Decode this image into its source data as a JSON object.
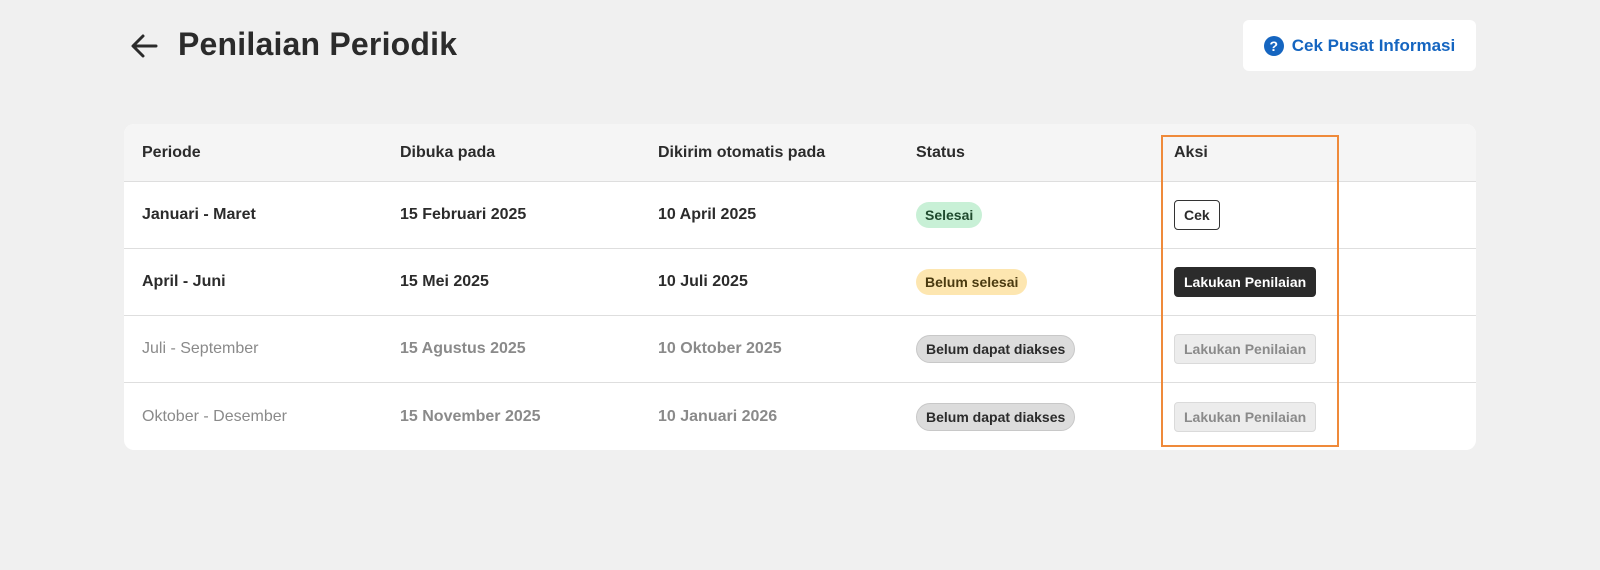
{
  "header": {
    "title": "Penilaian Periodik",
    "info_button_label": "Cek Pusat Informasi",
    "info_icon_glyph": "?"
  },
  "table": {
    "columns": [
      "Periode",
      "Dibuka pada",
      "Dikirim otomatis pada",
      "Status",
      "Aksi"
    ],
    "rows": [
      {
        "period": "Januari - Maret",
        "opened": "15 Februari 2025",
        "sent": "10 April 2025",
        "status": "Selesai",
        "action": "Cek"
      },
      {
        "period": "April - Juni",
        "opened": "15 Mei 2025",
        "sent": "10 Juli 2025",
        "status": "Belum selesai",
        "action": "Lakukan Penilaian"
      },
      {
        "period": "Juli - September",
        "opened": "15 Agustus 2025",
        "sent": "10 Oktober 2025",
        "status": "Belum dapat diakses",
        "action": "Lakukan Penilaian"
      },
      {
        "period": "Oktober - Desember",
        "opened": "15 November 2025",
        "sent": "10 Januari 2026",
        "status": "Belum dapat diakses",
        "action": "Lakukan Penilaian"
      }
    ]
  },
  "colors": {
    "accent_link": "#1565c0",
    "status_done": "#c8f0d6",
    "status_pending": "#fde6b0",
    "status_locked": "#dcdcdc",
    "highlight": "#ef8a3a"
  },
  "icons": {
    "back": "arrow-left-icon",
    "info": "question-circle-icon"
  }
}
